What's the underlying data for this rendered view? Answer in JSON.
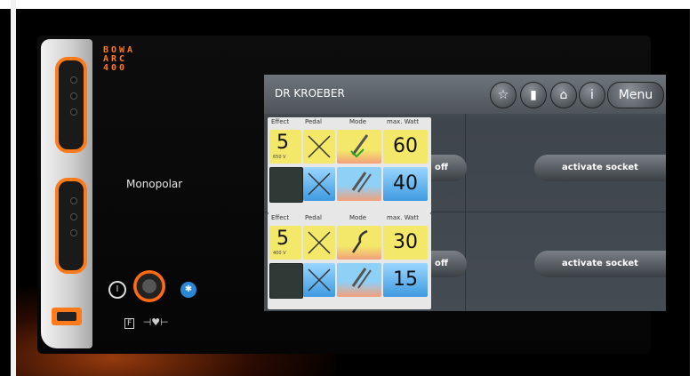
{
  "device": {
    "brand": [
      "BOWA",
      "ARC",
      "400"
    ],
    "mode_label": "Monopolar",
    "power_symbol": "I",
    "footer_f": "F"
  },
  "screen": {
    "user_name": "DR KROEBER",
    "menu_label": "Menu",
    "header_icons": [
      "star-icon",
      "book-icon",
      "lock-open-icon",
      "info-icon"
    ],
    "info_glyph": "i",
    "channels": [
      {
        "headers": [
          "Effect",
          "Pedal",
          "Mode",
          "max. Watt"
        ],
        "effect_value": "5",
        "voltage": "650 V",
        "watt_top": "60",
        "watt_bottom": "40",
        "off_label": "off",
        "activate_label": "activate socket"
      },
      {
        "headers": [
          "Effect",
          "Pedal",
          "Mode",
          "max. Watt"
        ],
        "effect_value": "5",
        "voltage": "400 V",
        "watt_top": "30",
        "watt_bottom": "15",
        "off_label": "off",
        "activate_label": "activate socket"
      }
    ]
  },
  "colors": {
    "accent_orange": "#ff7a1a",
    "yellow": "#f3e86a",
    "blue": "#3f9ae0",
    "screen_bg": "#454b52"
  }
}
